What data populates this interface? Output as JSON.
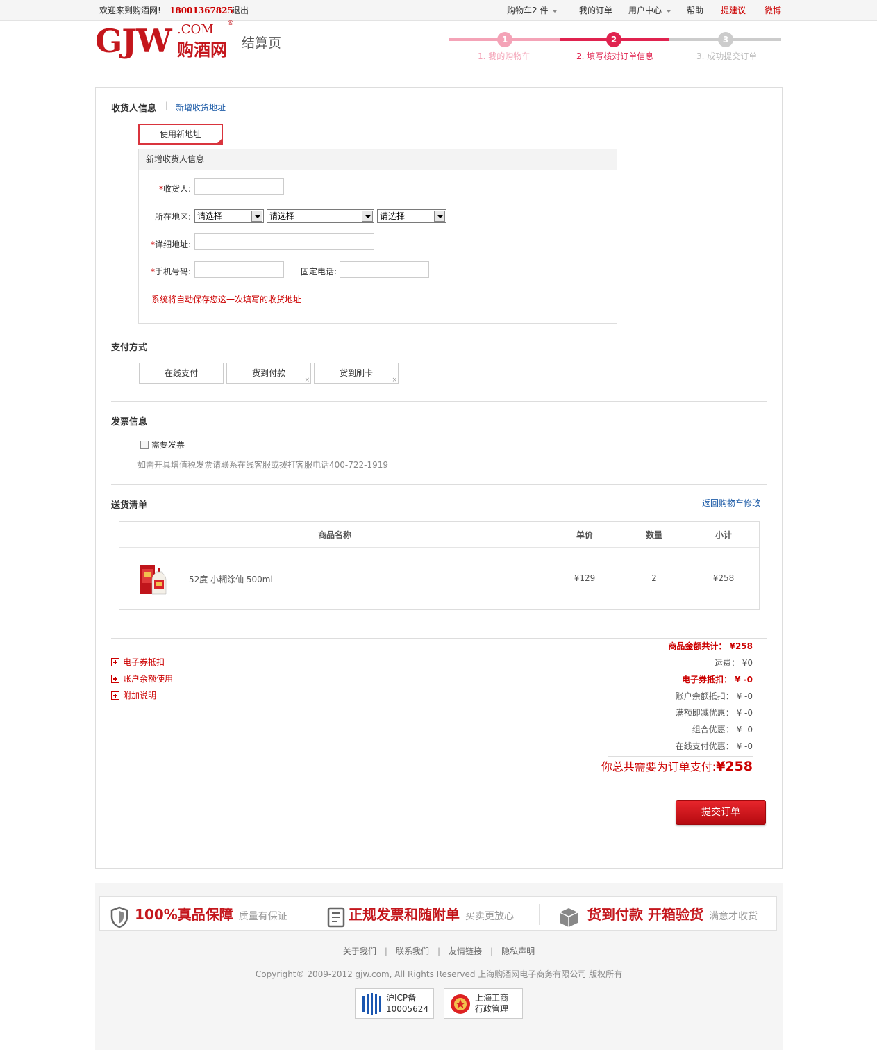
{
  "topbar": {
    "welcome": "欢迎来到购酒网!",
    "phone": "18001367825",
    "logout": "退出",
    "cart": "购物车2 件",
    "orders": "我的订单",
    "user_center": "用户中心",
    "help": "帮助",
    "suggest": "提建议",
    "weibo": "微博"
  },
  "header": {
    "logo_gjw": "GJW",
    "logo_com": ".COM",
    "logo_cn": "购酒网",
    "logo_reg": "®",
    "page_title": "结算页"
  },
  "steps": [
    {
      "num": "1",
      "label": "1. 我的购物车"
    },
    {
      "num": "2",
      "label": "2. 填写核对订单信息"
    },
    {
      "num": "3",
      "label": "3. 成功提交订单"
    }
  ],
  "receiver": {
    "title": "收货人信息",
    "separator": "|",
    "add_link": "新增收货地址",
    "use_new_btn": "使用新地址",
    "form_header": "新增收货人信息",
    "name_label": "收货人:",
    "region_label": "所在地区:",
    "select_default": "请选择",
    "address_label": "详细地址:",
    "mobile_label": "手机号码:",
    "phone_label": "固定电话:",
    "autosave_note": "系统将自动保存您这一次填写的收货地址",
    "required_mark": "*"
  },
  "payment": {
    "title": "支付方式",
    "options": [
      "在线支付",
      "货到付款",
      "货到刷卡"
    ]
  },
  "invoice": {
    "title": "发票信息",
    "checkbox_label": "需要发票",
    "note": "如需开具增值税发票请联系在线客服或拨打客服电话400-722-1919"
  },
  "delivery": {
    "title": "送货清单",
    "back_link": "返回购物车修改",
    "columns": [
      "商品名称",
      "单价",
      "数量",
      "小计"
    ],
    "items": [
      {
        "name": "52度 小糊涂仙 500ml",
        "price": "¥129",
        "qty": "2",
        "subtotal": "¥258"
      }
    ]
  },
  "extras": [
    "电子券抵扣",
    "账户余额使用",
    "附加说明"
  ],
  "totals": {
    "goods": "商品金额共计： ¥258",
    "shipping": "运费： ¥0",
    "coupon": "电子券抵扣： ¥ -0",
    "balance": "账户余额抵扣： ¥ -0",
    "full_reduce": "满额即减优惠： ¥ -0",
    "combo": "组合优惠： ¥ -0",
    "online_pay": "在线支付优惠： ¥ -0",
    "grand_label": "你总共需要为订单支付:",
    "grand_value": "¥258"
  },
  "submit_label": "提交订单",
  "footer": {
    "g1_big": "100%真品保障",
    "g1_small": "质量有保证",
    "g2_big": "正规发票和随附单",
    "g2_small": "买卖更放心",
    "g3_big": "货到付款 开箱验货",
    "g3_small": "满意才收货",
    "links": [
      "关于我们",
      "联系我们",
      "友情链接",
      "隐私声明"
    ],
    "link_sep": "|",
    "copyright": "Copyright® 2009-2012 gjw.com, All Rights Reserved 上海购酒网电子商务有限公司 版权所有",
    "badge1_line1": "沪ICP备",
    "badge1_line2": "10005624",
    "badge2_line1": "上海工商",
    "badge2_line2": "行政管理"
  },
  "colors": {
    "brand_red": "#c4161c",
    "step_pink": "#f4a3b7",
    "step_active": "#e0234f",
    "step_gray": "#cccccc",
    "link_blue": "#1f5da8"
  }
}
